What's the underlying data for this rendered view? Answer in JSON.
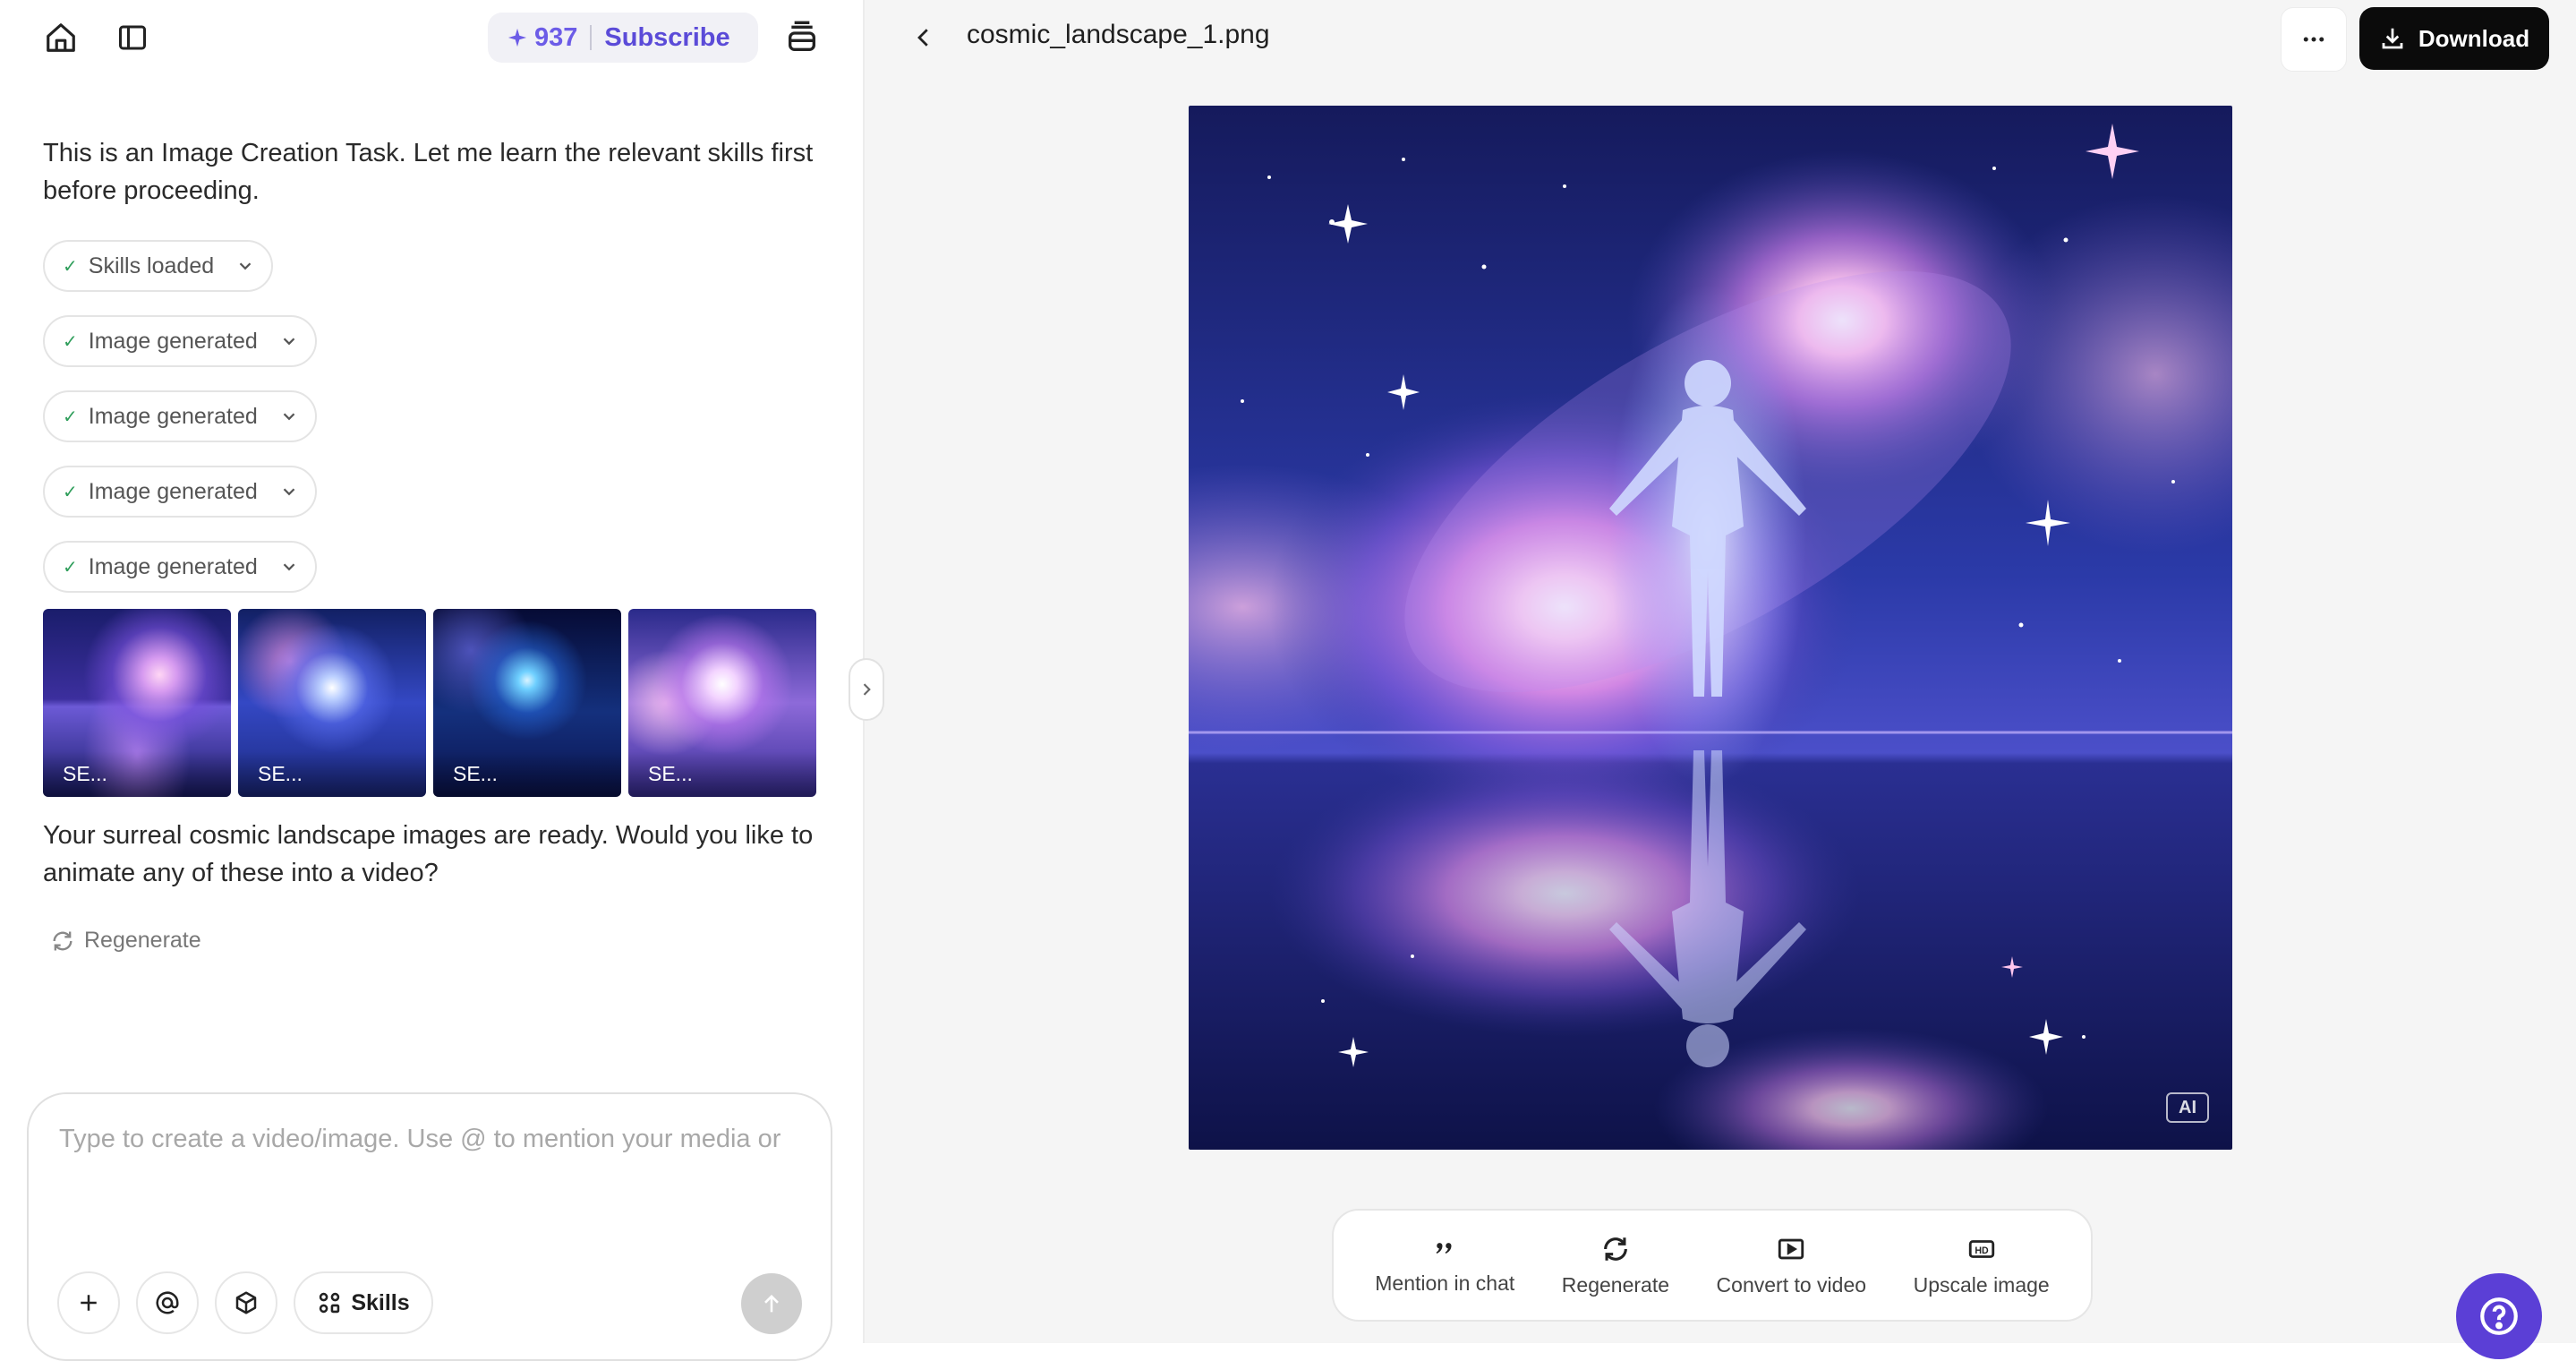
{
  "header": {
    "credits": "937",
    "subscribe_label": "Subscribe"
  },
  "chat": {
    "intro_message": "This is an Image Creation Task. Let me learn the relevant skills first before proceeding.",
    "steps": [
      {
        "label": "Skills loaded"
      },
      {
        "label": "Image generated"
      },
      {
        "label": "Image generated"
      },
      {
        "label": "Image generated"
      },
      {
        "label": "Image generated"
      }
    ],
    "thumbnails": [
      {
        "label": "SE..."
      },
      {
        "label": "SE..."
      },
      {
        "label": "SE..."
      },
      {
        "label": "SE..."
      }
    ],
    "result_message": "Your surreal cosmic landscape images are ready. Would you like to animate any of these into a video?",
    "regenerate_label": "Regenerate"
  },
  "composer": {
    "placeholder": "Type to create a video/image. Use @ to mention your media or",
    "skills_label": "Skills"
  },
  "viewer": {
    "filename": "cosmic_landscape_1.png",
    "download_label": "Download",
    "ai_badge": "AI",
    "actions": [
      {
        "label": "Mention in chat",
        "icon": "quote-icon"
      },
      {
        "label": "Regenerate",
        "icon": "refresh-icon"
      },
      {
        "label": "Convert to video",
        "icon": "video-icon"
      },
      {
        "label": "Upscale image",
        "icon": "hd-icon"
      }
    ]
  },
  "colors": {
    "accent": "#5b4bd8",
    "download_bg": "#0b0b0b",
    "help_bg": "#5b3fd6",
    "check": "#2f9e5b"
  }
}
